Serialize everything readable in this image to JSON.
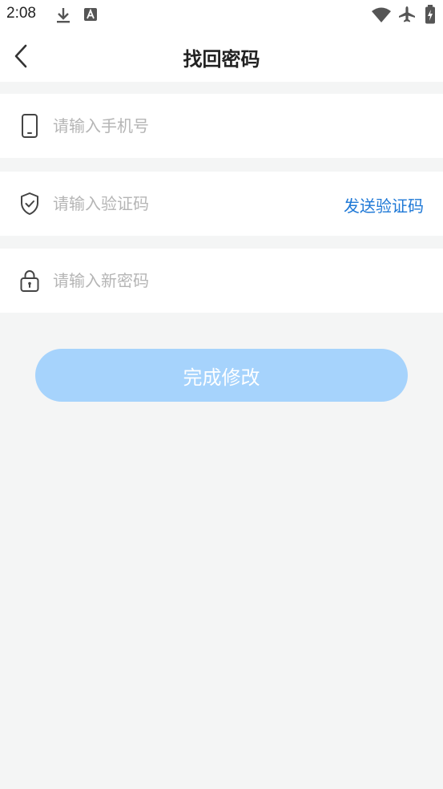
{
  "status_bar": {
    "time": "2:08",
    "icons": [
      "download-icon",
      "font-a-icon",
      "wifi-icon",
      "airplane-icon",
      "battery-icon"
    ]
  },
  "header": {
    "title": "找回密码",
    "back_icon": "back-arrow-icon"
  },
  "form": {
    "phone": {
      "placeholder": "请输入手机号",
      "value": "",
      "icon": "phone-icon"
    },
    "code": {
      "placeholder": "请输入验证码",
      "value": "",
      "icon": "shield-check-icon",
      "send_label": "发送验证码"
    },
    "password": {
      "placeholder": "请输入新密码",
      "value": "",
      "icon": "lock-icon"
    },
    "submit_label": "完成修改"
  },
  "colors": {
    "background": "#f4f5f5",
    "accent": "#1e78d6",
    "button_disabled": "#a6d3fc"
  }
}
